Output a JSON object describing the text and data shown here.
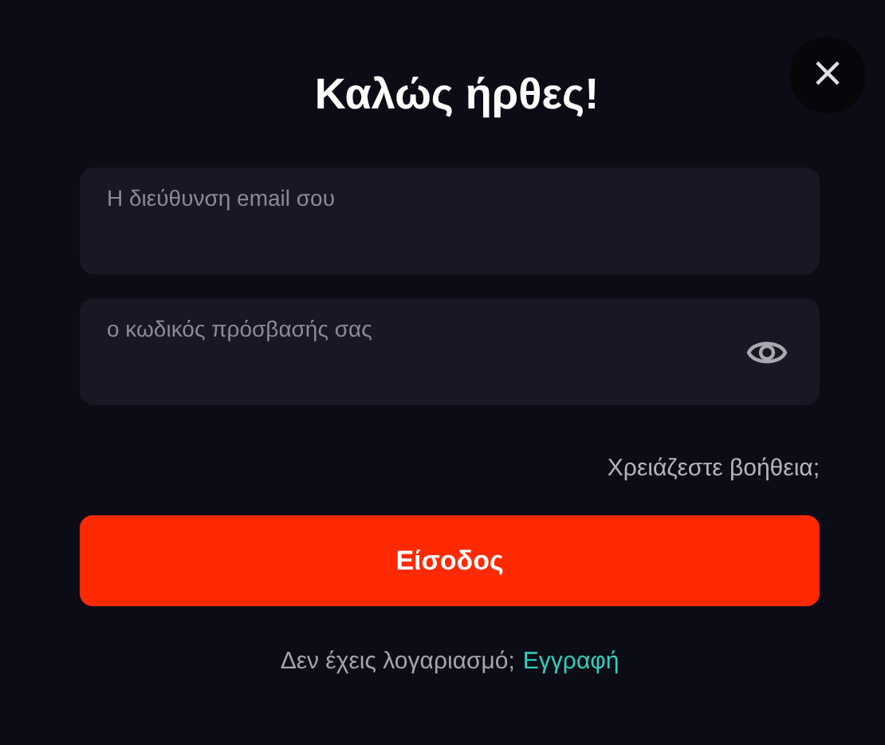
{
  "title": "Καλώς ήρθες!",
  "close_button": {
    "label": "×"
  },
  "fields": [
    {
      "placeholder": "Η διεύθυνση email σου",
      "kind": "text"
    },
    {
      "placeholder": "ο κωδικός πρόσβασής σας",
      "kind": "password"
    }
  ],
  "help_link": "Χρειάζεστε βοήθεια;",
  "submit_button": "Είσοδος",
  "footer": {
    "text": "Δεν έχεις λογαριασμό;",
    "link": "Εγγραφή"
  }
}
